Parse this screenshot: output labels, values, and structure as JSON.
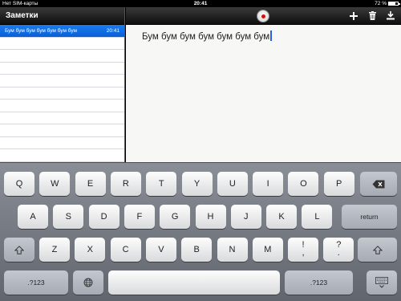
{
  "status": {
    "carrier": "Нет SIM-карты",
    "time": "20:41",
    "battery": "72 %",
    "battery_fraction": 0.72
  },
  "sidebar": {
    "title": "Заметки",
    "notes": [
      {
        "title": "Бум бум бум бум бум бум бум",
        "time": "20:41",
        "selected": true
      }
    ]
  },
  "toolbar": {
    "icons": [
      "record-icon",
      "add-icon",
      "trash-icon",
      "download-icon"
    ]
  },
  "note": {
    "text": "Бум бум бум бум бум бум бум"
  },
  "keyboard": {
    "row1": [
      "Q",
      "W",
      "E",
      "R",
      "T",
      "Y",
      "U",
      "I",
      "O",
      "P"
    ],
    "row2": [
      "A",
      "S",
      "D",
      "F",
      "G",
      "H",
      "J",
      "K",
      "L"
    ],
    "return_label": "return",
    "row3": [
      "Z",
      "X",
      "C",
      "V",
      "B",
      "N",
      "M"
    ],
    "row3_punct": [
      [
        "!",
        ","
      ],
      [
        "?",
        "."
      ]
    ],
    "numbers_label": ".?123",
    "colors": {
      "selection": "#0a6ee6",
      "record": "#d01010",
      "caret": "#2a5ee8"
    }
  }
}
